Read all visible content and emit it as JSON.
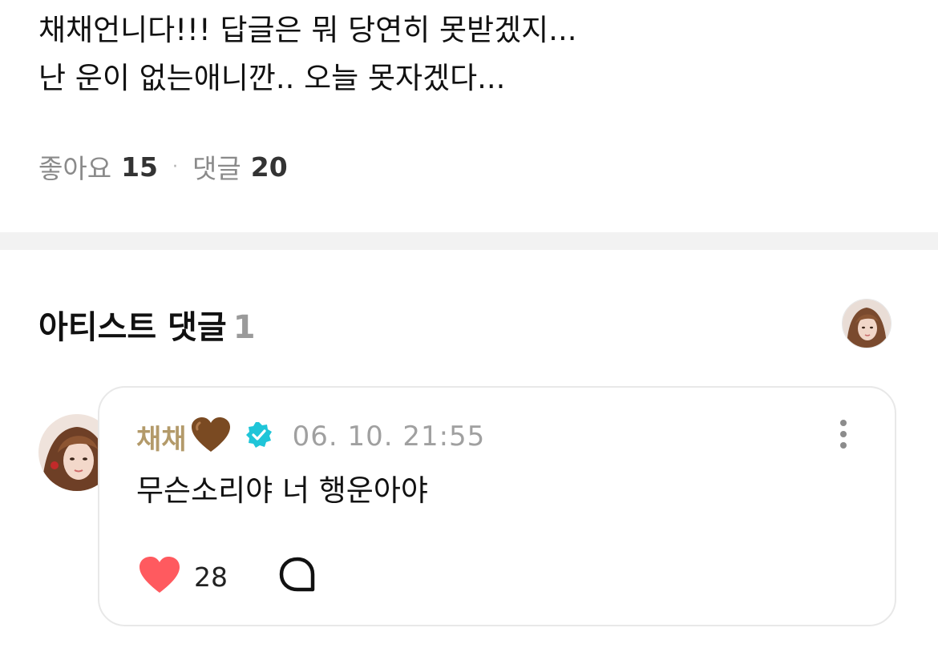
{
  "post": {
    "lines": [
      "채채언니다!!! 답글은 뭐 당연히 못받겠지...",
      "난 운이 없는애니깐.. 오늘 못자겠다..."
    ],
    "likes_label": "좋아요",
    "likes_count": "15",
    "separator": "·",
    "comments_label": "댓글",
    "comments_count": "20"
  },
  "artist_section": {
    "title": "아티스트 댓글",
    "count": "1"
  },
  "comment": {
    "author": "채채",
    "author_emoji": "brown-heart",
    "verified": "verified-badge-icon",
    "timestamp": "06. 10. 21:55",
    "text": "무슨소리야 너 행운아야",
    "like_count": "28",
    "author_color": "#b39a6a",
    "like_color": "#ff5a5f",
    "verified_color": "#1fc5d8"
  }
}
